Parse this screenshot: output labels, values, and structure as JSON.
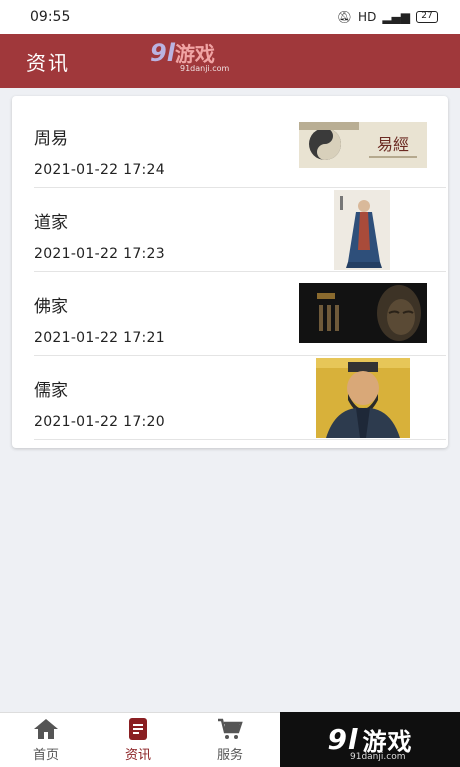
{
  "status_bar": {
    "time": "09:55",
    "network": "HD",
    "signal": "⁴⁶ᴵˡ",
    "battery": "27"
  },
  "header": {
    "title": "资讯"
  },
  "watermark": {
    "logo_big": "9l",
    "logo_cn": "游戏",
    "logo_url": "91danji.com"
  },
  "news": [
    {
      "title": "周易",
      "time": "2021-01-22 17:24",
      "thumb_icon": "zhouyi-thumbnail"
    },
    {
      "title": "道家",
      "time": "2021-01-22 17:23",
      "thumb_icon": "daoist-figure-thumbnail"
    },
    {
      "title": "佛家",
      "time": "2021-01-22 17:21",
      "thumb_icon": "buddha-thumbnail"
    },
    {
      "title": "儒家",
      "time": "2021-01-22 17:20",
      "thumb_icon": "confucius-thumbnail"
    }
  ],
  "tabs": [
    {
      "label": "首页",
      "icon": "home-icon",
      "active": false
    },
    {
      "label": "资讯",
      "icon": "news-icon",
      "active": true
    },
    {
      "label": "服务",
      "icon": "cart-icon",
      "active": false
    }
  ],
  "colors": {
    "accent": "#a0383b",
    "tab_active": "#8a1f22",
    "background": "#eef0f4"
  }
}
